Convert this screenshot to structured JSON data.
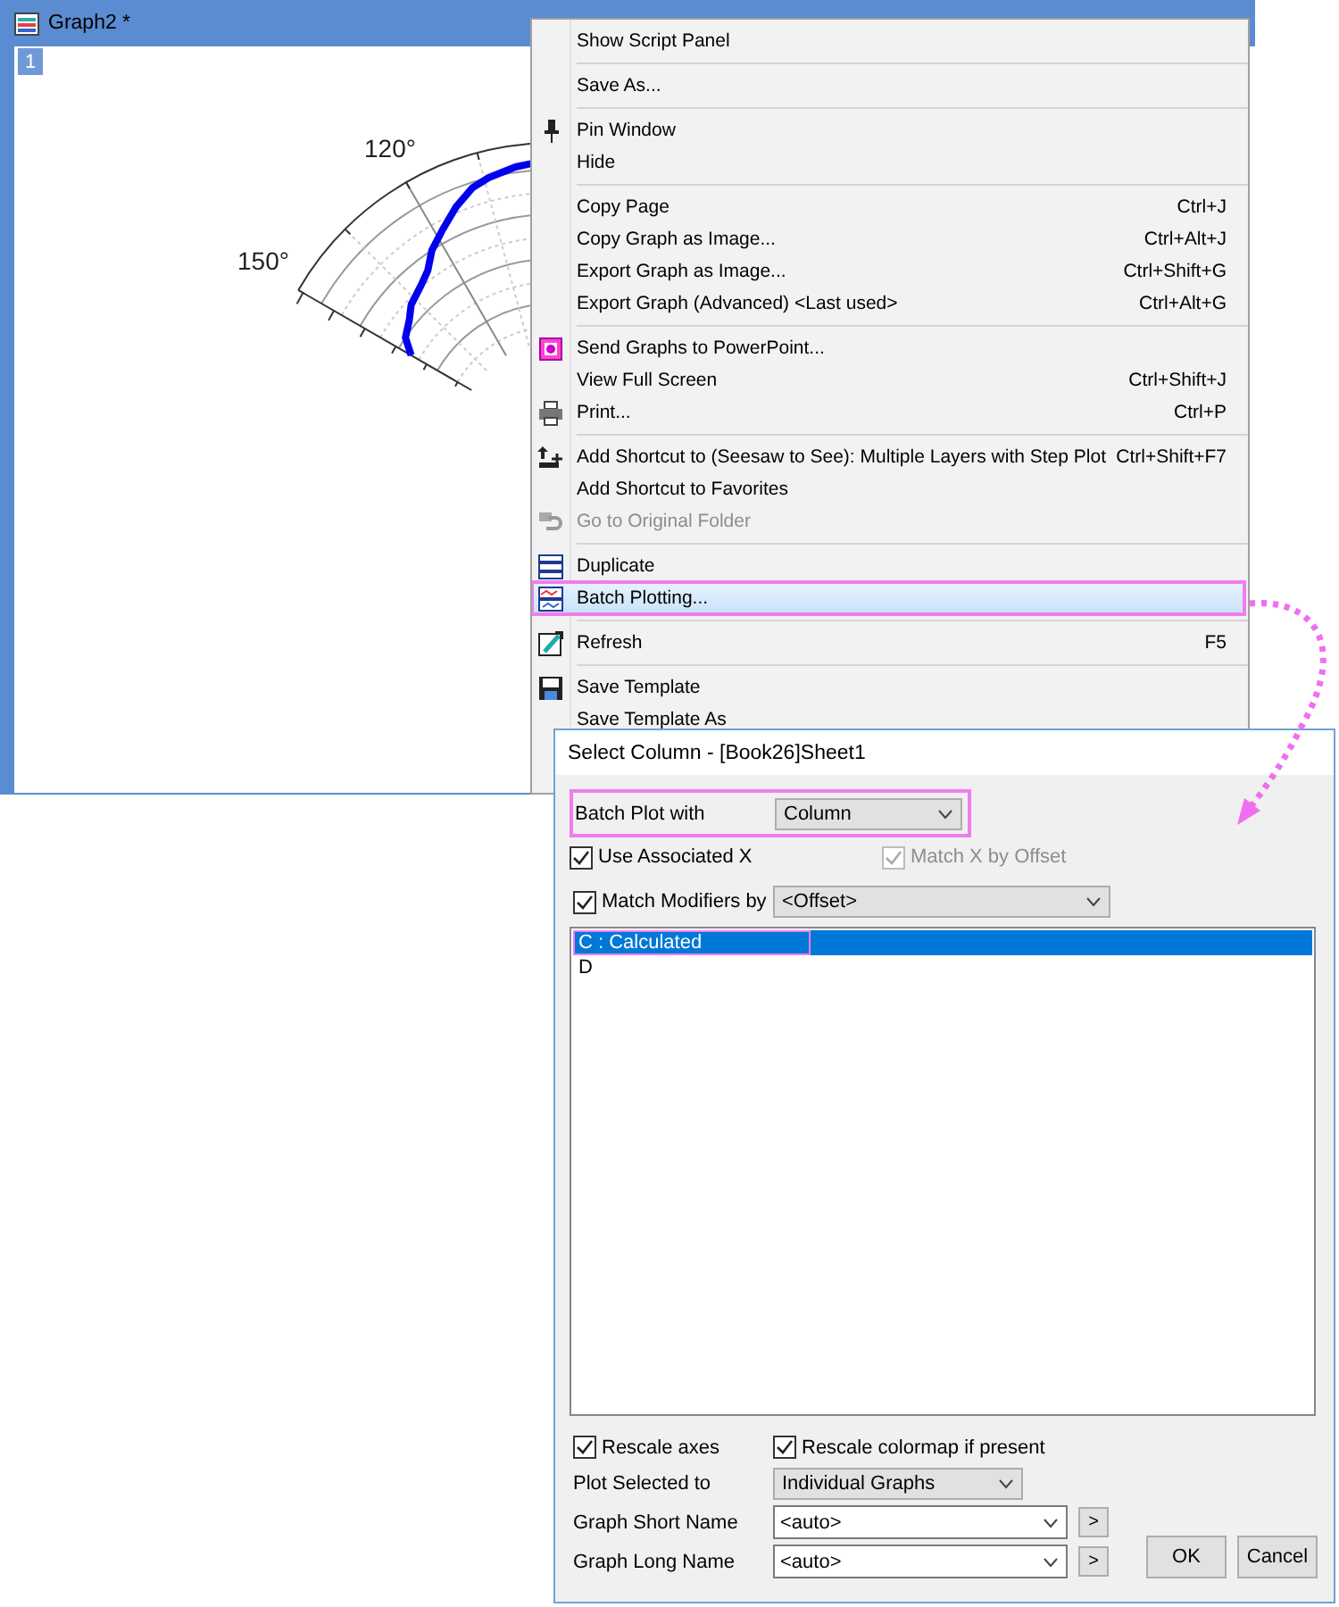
{
  "graph_window": {
    "title": "Graph2 *",
    "layer": "1",
    "angle_labels": [
      "120°",
      "150°"
    ]
  },
  "context_menu": {
    "entries": [
      {
        "kind": "item",
        "label": "Show Script Panel",
        "disabled": false,
        "highlighted": false
      },
      {
        "kind": "separator"
      },
      {
        "kind": "item",
        "label": "Save As...",
        "disabled": false,
        "highlighted": false
      },
      {
        "kind": "separator"
      },
      {
        "kind": "item",
        "label": "Pin Window",
        "disabled": false,
        "highlighted": false
      },
      {
        "kind": "item",
        "label": "Hide",
        "disabled": false,
        "highlighted": false
      },
      {
        "kind": "separator"
      },
      {
        "kind": "item",
        "label": "Copy Page",
        "shortcut": "Ctrl+J",
        "disabled": false,
        "highlighted": false
      },
      {
        "kind": "item",
        "label": "Copy Graph as Image...",
        "shortcut": "Ctrl+Alt+J",
        "disabled": false,
        "highlighted": false
      },
      {
        "kind": "item",
        "label": "Export Graph as Image...",
        "shortcut": "Ctrl+Shift+G",
        "disabled": false,
        "highlighted": false
      },
      {
        "kind": "item",
        "label": "Export Graph (Advanced) <Last used>",
        "shortcut": "Ctrl+Alt+G",
        "disabled": false,
        "highlighted": false
      },
      {
        "kind": "separator"
      },
      {
        "kind": "item",
        "label": "Send Graphs to PowerPoint...",
        "disabled": false,
        "highlighted": false
      },
      {
        "kind": "item",
        "label": "View Full Screen",
        "shortcut": "Ctrl+Shift+J",
        "disabled": false,
        "highlighted": false
      },
      {
        "kind": "item",
        "label": "Print...",
        "shortcut": "Ctrl+P",
        "disabled": false,
        "highlighted": false
      },
      {
        "kind": "separator"
      },
      {
        "kind": "item",
        "label": "Add Shortcut to (Seesaw to See): Multiple Layers with Step Plot",
        "shortcut": "Ctrl+Shift+F7",
        "disabled": false,
        "highlighted": false
      },
      {
        "kind": "item",
        "label": "Add Shortcut to Favorites",
        "disabled": false,
        "highlighted": false
      },
      {
        "kind": "item",
        "label": "Go to Original Folder",
        "disabled": true,
        "highlighted": false
      },
      {
        "kind": "separator"
      },
      {
        "kind": "item",
        "label": "Duplicate",
        "disabled": false,
        "highlighted": false
      },
      {
        "kind": "item",
        "label": "Batch Plotting...",
        "disabled": false,
        "highlighted": true
      },
      {
        "kind": "separator"
      },
      {
        "kind": "item",
        "label": "Refresh",
        "shortcut": "F5",
        "disabled": false,
        "highlighted": false
      },
      {
        "kind": "separator"
      },
      {
        "kind": "item",
        "label": "Save Template",
        "disabled": false,
        "highlighted": false
      },
      {
        "kind": "item",
        "label": "Save Template As",
        "disabled": false,
        "highlighted": false
      }
    ]
  },
  "dialog": {
    "title": "Select Column - [Book26]Sheet1",
    "batch_plot_with": {
      "label": "Batch Plot with",
      "value": "Column",
      "highlighted": true
    },
    "use_associated_x": {
      "label": "Use Associated X",
      "checked": true,
      "disabled": false
    },
    "match_x_by_offset": {
      "label": "Match X by Offset",
      "checked": true,
      "disabled": true
    },
    "match_modifiers_by": {
      "label": "Match Modifiers by",
      "checked": true,
      "disabled": false,
      "value": "<Offset>"
    },
    "columns": [
      {
        "label": "C : Calculated",
        "selected": true,
        "highlighted": true
      },
      {
        "label": "D",
        "selected": false,
        "highlighted": false
      }
    ],
    "rescale_axes": {
      "label": "Rescale axes",
      "checked": true,
      "disabled": false
    },
    "rescale_colormap": {
      "label": "Rescale colormap if present",
      "checked": true,
      "disabled": false
    },
    "plot_selected_to": {
      "label": "Plot Selected to",
      "value": "Individual Graphs"
    },
    "graph_short_name": {
      "label": "Graph Short Name",
      "value": "<auto>",
      "button": ">"
    },
    "graph_long_name": {
      "label": "Graph Long Name",
      "value": "<auto>",
      "button": ">"
    },
    "buttons": [
      "OK",
      "Cancel"
    ]
  }
}
